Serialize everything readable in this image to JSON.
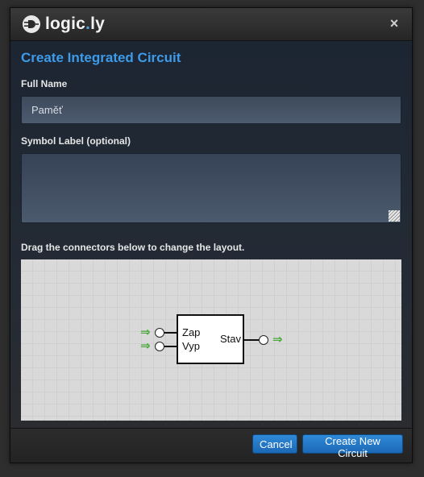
{
  "app": {
    "logo_main": "logic",
    "logo_dot": ".",
    "logo_tail": "ly"
  },
  "dialog": {
    "title": "Create Integrated Circuit",
    "full_name_label": "Full Name",
    "full_name_value": "Paměť",
    "symbol_label": "Symbol Label (optional)",
    "symbol_value": "",
    "hint": "Drag the connectors below to change the layout."
  },
  "circuit": {
    "inputs": [
      "Zap",
      "Vyp"
    ],
    "outputs": [
      "Stav"
    ]
  },
  "buttons": {
    "cancel": "Cancel",
    "create": "Create New Circuit"
  },
  "icons": {
    "close": "close-icon",
    "logo": "logic-gate-plug-icon",
    "resize": "resize-grip-icon",
    "arrow": "right-arrow-icon"
  },
  "colors": {
    "accent": "#3d9be9",
    "button": "#1f72c0",
    "arrow": "#49a93a"
  }
}
